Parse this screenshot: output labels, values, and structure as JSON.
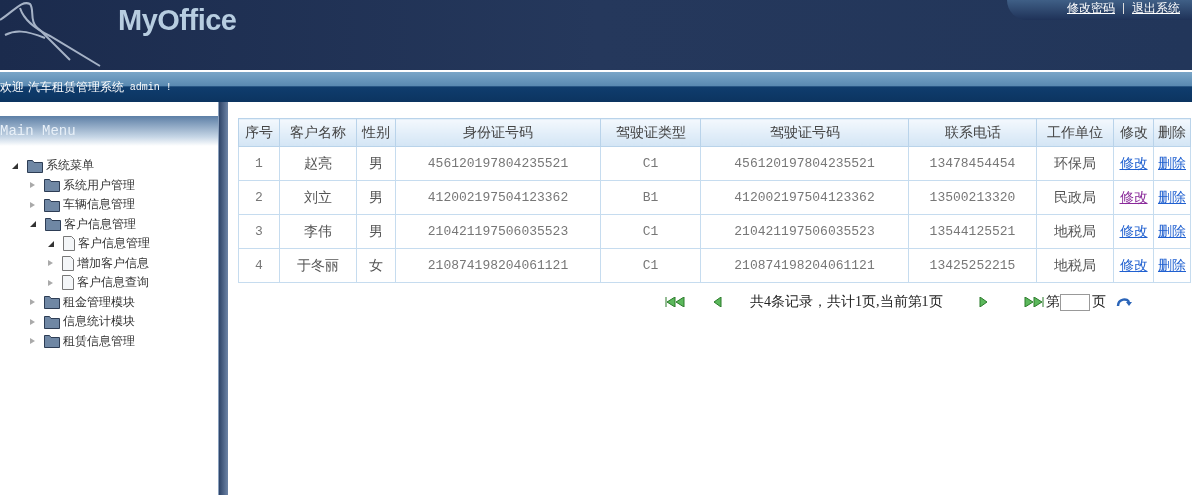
{
  "header": {
    "logo": "MyOffice",
    "links": [
      "修改密码",
      "退出系统"
    ]
  },
  "welcome": {
    "text": "欢迎 汽车租赁管理系统",
    "user": "admin !"
  },
  "sidebar": {
    "title": "Main Menu",
    "items": [
      {
        "label": "系统菜单",
        "kind": "folder",
        "expanded": true,
        "children": [
          {
            "label": "系统用户管理",
            "kind": "folder",
            "expanded": false
          },
          {
            "label": "车辆信息管理",
            "kind": "folder",
            "expanded": false
          },
          {
            "label": "客户信息管理",
            "kind": "folder",
            "expanded": true,
            "children": [
              {
                "label": "客户信息管理",
                "kind": "page",
                "expanded": true
              },
              {
                "label": "增加客户信息",
                "kind": "page",
                "expanded": false
              },
              {
                "label": "客户信息查询",
                "kind": "page",
                "expanded": false
              }
            ]
          },
          {
            "label": "租金管理模块",
            "kind": "folder",
            "expanded": false
          },
          {
            "label": "信息统计模块",
            "kind": "folder",
            "expanded": false
          },
          {
            "label": "租赁信息管理",
            "kind": "folder",
            "expanded": false
          }
        ]
      }
    ]
  },
  "table": {
    "columns": [
      "序号",
      "客户名称",
      "性别",
      "身份证号码",
      "驾驶证类型",
      "驾驶证号码",
      "联系电话",
      "工作单位",
      "修改",
      "删除"
    ],
    "rows": [
      {
        "cells": [
          "1",
          "赵亮",
          "男",
          "456120197804235521",
          "C1",
          "456120197804235521",
          "13478454454",
          "环保局"
        ],
        "edit": "修改",
        "edit_visited": false,
        "delete": "删除"
      },
      {
        "cells": [
          "2",
          "刘立",
          "男",
          "412002197504123362",
          "B1",
          "412002197504123362",
          "13500213320",
          "民政局"
        ],
        "edit": "修改",
        "edit_visited": true,
        "delete": "删除"
      },
      {
        "cells": [
          "3",
          "李伟",
          "男",
          "210421197506035523",
          "C1",
          "210421197506035523",
          "13544125521",
          "地税局"
        ],
        "edit": "修改",
        "edit_visited": false,
        "delete": "删除"
      },
      {
        "cells": [
          "4",
          "于冬丽",
          "女",
          "210874198204061121",
          "C1",
          "210874198204061121",
          "13425252215",
          "地税局"
        ],
        "edit": "修改",
        "edit_visited": false,
        "delete": "删除"
      }
    ]
  },
  "pager": {
    "summary": "共4条记录，共计1页,当前第1页",
    "before_input": "第",
    "after_input": "页"
  }
}
